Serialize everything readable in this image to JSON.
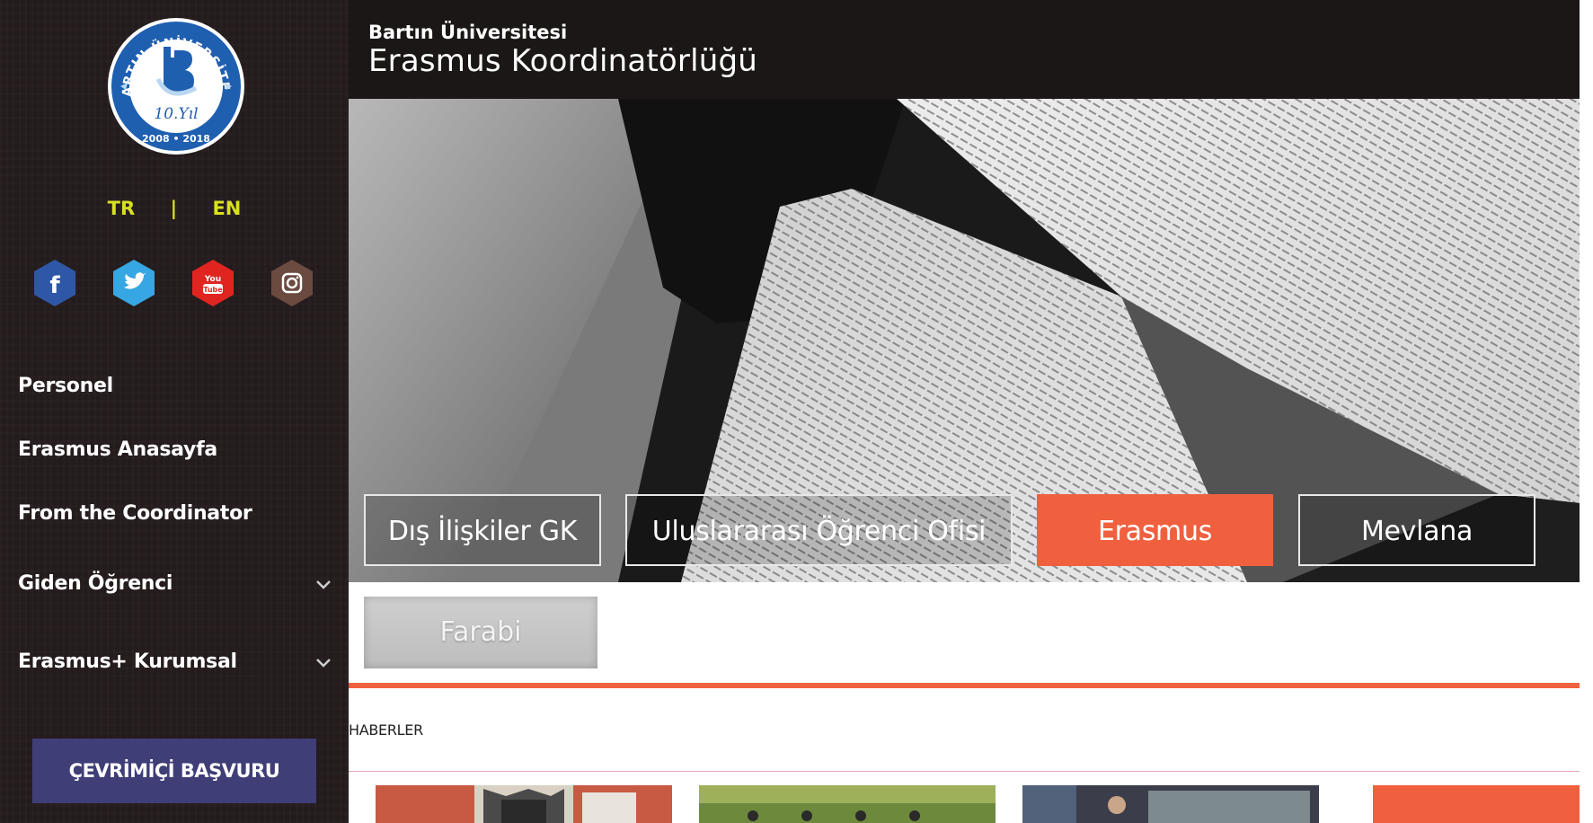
{
  "sidebar": {
    "logo": {
      "arc_text": "BARTIN ÜNİVERSİTESİ",
      "center_text": "10.Yıl",
      "years": "2008 • 2018",
      "colors": {
        "ring": "#1f5fb0",
        "accent": "#b9d7f2"
      }
    },
    "lang": {
      "tr": "TR",
      "sep": "|",
      "en": "EN",
      "color": "#d7e11e"
    },
    "social": [
      {
        "name": "facebook-icon",
        "label": "f",
        "color": "#2f57a7"
      },
      {
        "name": "twitter-icon",
        "label": "",
        "color": "#37a7e3"
      },
      {
        "name": "youtube-icon",
        "label": "You Tube",
        "color": "#e02520"
      },
      {
        "name": "instagram-icon",
        "label": "",
        "color": "#6b4a40"
      }
    ],
    "nav": [
      {
        "label": "Personel",
        "has_children": false
      },
      {
        "label": "Erasmus Anasayfa",
        "has_children": false
      },
      {
        "label": "From the Coordinator",
        "has_children": false
      },
      {
        "label": "Giden Öğrenci",
        "has_children": true
      },
      {
        "label": "Erasmus+ Kurumsal",
        "has_children": true
      }
    ],
    "chevron": "⌄",
    "apply_button": "ÇEVRİMİÇİ BAŞVURU"
  },
  "header": {
    "subtitle": "Bartın Üniversitesi",
    "title": "Erasmus Koordinatörlüğü"
  },
  "hero": {
    "buttons": [
      {
        "label": "Dış İlişkiler GK",
        "active": false
      },
      {
        "label": "Uluslararası Öğrenci Ofisi",
        "active": false
      },
      {
        "label": "Erasmus",
        "active": true
      },
      {
        "label": "Mevlana",
        "active": false
      }
    ],
    "accent_color": "#f0603f"
  },
  "secondary_button": "Farabi",
  "news": {
    "heading": "HABERLER"
  }
}
